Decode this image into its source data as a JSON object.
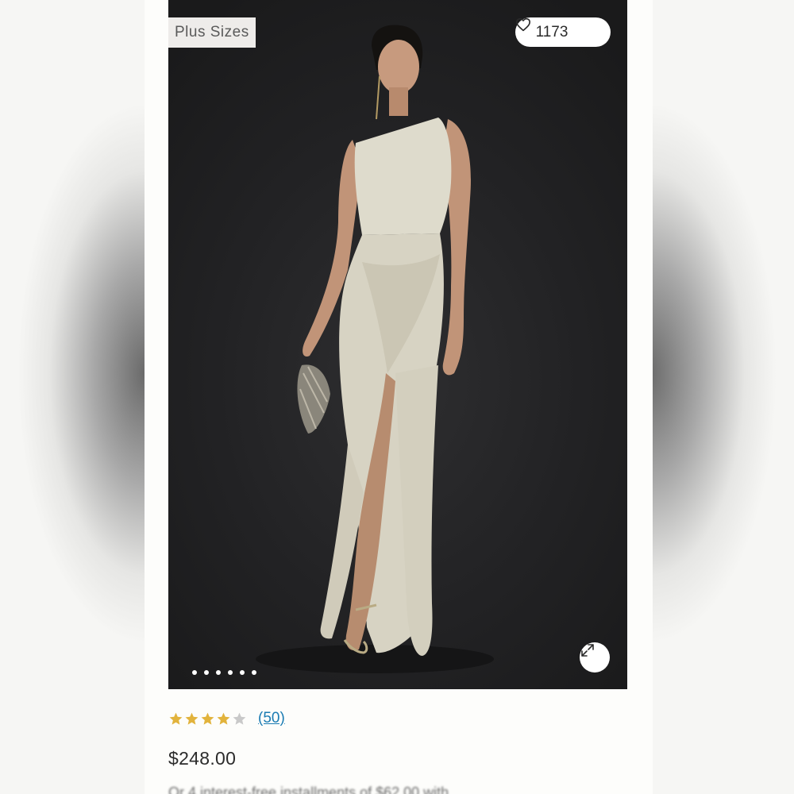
{
  "product": {
    "badge": "Plus Sizes",
    "wishlist_count": "1173",
    "image_dot_count": 6,
    "rating": {
      "value": 4,
      "max": 5,
      "reviews_label": "(50)"
    },
    "price": "$248.00",
    "promo_text": "Or 4 interest-free installments of $62.00 with"
  },
  "icons": {
    "wishlist": "heart-icon",
    "expand": "expand-icon",
    "star": "star-icon"
  },
  "colors": {
    "star_filled": "#e2b33c",
    "star_empty": "#c9c9c9",
    "link": "#1b7cb3",
    "photo_background": "#222224",
    "dress": "#d9d6c6"
  }
}
